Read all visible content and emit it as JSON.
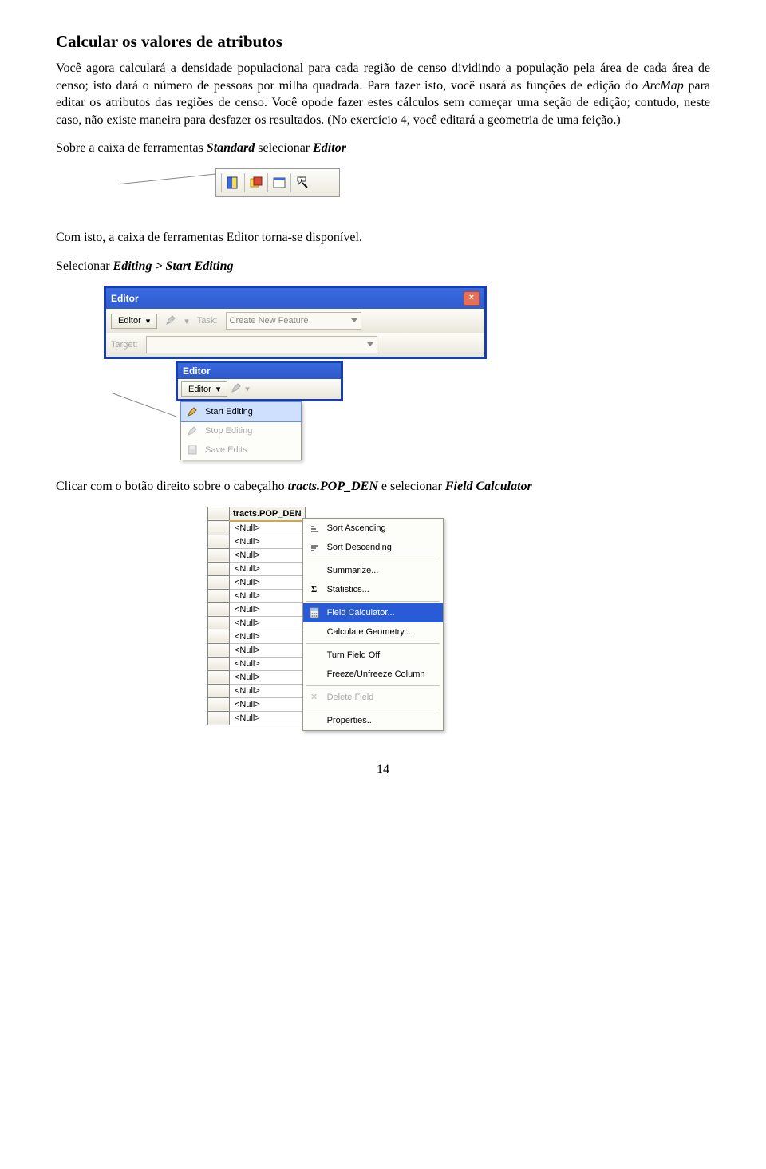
{
  "heading": "Calcular os valores de atributos",
  "para1": "Você agora calculará a densidade populacional para cada região de censo dividindo a população pela área de cada área de censo; isto dará o número de pessoas por milha quadrada. Para fazer isto, você usará as funções de edição do ",
  "para1_em1": "ArcMap",
  "para1_cont": " para editar os atributos das regiões de censo. Você opode fazer estes cálculos sem começar uma seção de edição; contudo, neste caso, não existe maneira para desfazer os resultados. (No exercício 4, você editará a geometria de uma feição.)",
  "para2_a": "Sobre a caixa de ferramentas ",
  "para2_b": "Standard",
  "para2_c": " selecionar ",
  "para2_d": "Editor",
  "para3": "Com isto, a caixa de ferramentas Editor torna-se disponível.",
  "para4_a": "Selecionar ",
  "para4_b": "Editing > Start Editing",
  "editorToolbar": {
    "title": "Editor",
    "button": "Editor",
    "taskLabel": "Task:",
    "taskValue": "Create New Feature",
    "targetLabel": "Target:"
  },
  "editorMenu": {
    "title": "Editor",
    "button": "Editor",
    "items": {
      "start": "Start Editing",
      "stop": "Stop Editing",
      "save": "Save Edits"
    }
  },
  "para5_a": "Clicar com o botão direito sobre o cabeçalho ",
  "para5_b": "tracts.POP_DEN",
  "para5_c": " e selecionar ",
  "para5_d": "Field Calculator",
  "attrTable": {
    "header": "tracts.POP_DEN",
    "cell": "<Null>"
  },
  "contextMenu": {
    "sortAsc": "Sort Ascending",
    "sortDesc": "Sort Descending",
    "summarize": "Summarize...",
    "statistics": "Statistics...",
    "fieldCalc": "Field Calculator...",
    "calcGeom": "Calculate Geometry...",
    "turnOff": "Turn Field Off",
    "freeze": "Freeze/Unfreeze Column",
    "delete": "Delete Field",
    "properties": "Properties..."
  },
  "pageNumber": "14"
}
